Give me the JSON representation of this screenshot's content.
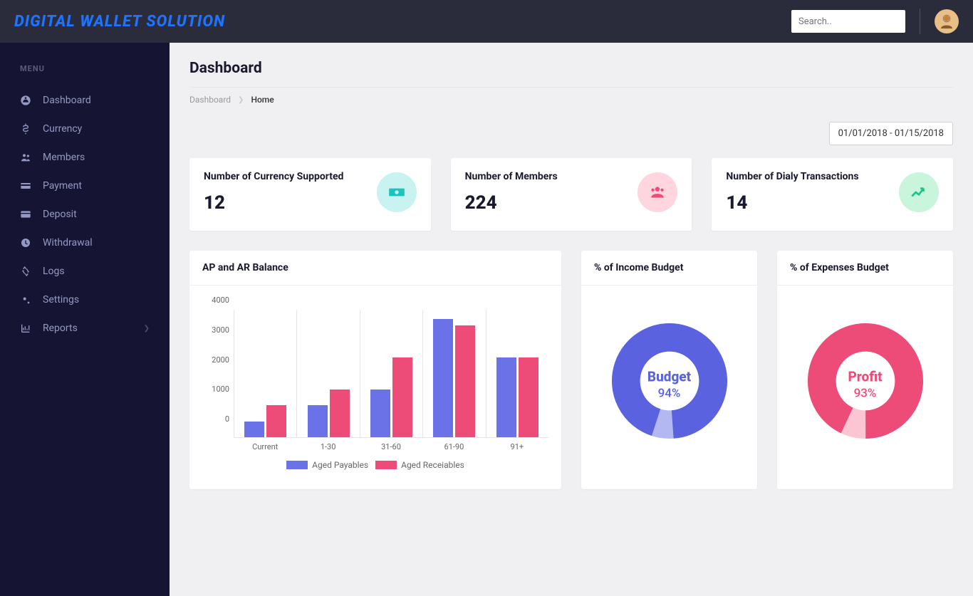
{
  "brand": "DIGITAL WALLET SOLUTION",
  "search": {
    "placeholder": "Search.."
  },
  "sidebar": {
    "menu_label": "MENU",
    "items": [
      {
        "label": "Dashboard",
        "icon": "dashboard-icon"
      },
      {
        "label": "Currency",
        "icon": "dollar-icon"
      },
      {
        "label": "Members",
        "icon": "users-icon"
      },
      {
        "label": "Payment",
        "icon": "payment-icon"
      },
      {
        "label": "Deposit",
        "icon": "card-icon"
      },
      {
        "label": "Withdrawal",
        "icon": "withdraw-icon"
      },
      {
        "label": "Logs",
        "icon": "recycle-icon"
      },
      {
        "label": "Settings",
        "icon": "gears-icon"
      },
      {
        "label": "Reports",
        "icon": "chart-icon",
        "has_children": true
      }
    ]
  },
  "page": {
    "title": "Dashboard",
    "breadcrumb": {
      "root": "Dashboard",
      "current": "Home"
    }
  },
  "date_range": "01/01/2018 - 01/15/2018",
  "stats": [
    {
      "label": "Number of Currency Supported",
      "value": "12",
      "icon": "money-icon",
      "color": "teal"
    },
    {
      "label": "Number of Members",
      "value": "224",
      "icon": "users-icon",
      "color": "pink"
    },
    {
      "label": "Number of Dialy Transactions",
      "value": "14",
      "icon": "trend-icon",
      "color": "green"
    }
  ],
  "charts": {
    "bar": {
      "title": "AP and AR Balance"
    },
    "income": {
      "title": "% of Income Budget",
      "center_label": "Budget",
      "percent": "94%"
    },
    "expense": {
      "title": "% of Expenses Budget",
      "center_label": "Profit",
      "percent": "93%"
    }
  },
  "chart_data": [
    {
      "type": "bar",
      "title": "AP and AR Balance",
      "categories": [
        "Current",
        "1-30",
        "31-60",
        "61-90",
        "91+"
      ],
      "series": [
        {
          "name": "Aged Payables",
          "values": [
            500,
            1000,
            1500,
            3700,
            2500
          ],
          "color": "#6b72e8"
        },
        {
          "name": "Aged Receiables",
          "values": [
            1000,
            1500,
            2500,
            3500,
            2500
          ],
          "color": "#ee4c78"
        }
      ],
      "ylim": [
        0,
        4000
      ],
      "yticks": [
        0,
        1000,
        2000,
        3000,
        4000
      ]
    },
    {
      "type": "pie",
      "title": "% of Income Budget",
      "center_label": "Budget",
      "series": [
        {
          "name": "Budget",
          "value": 94,
          "color": "#5a62e0"
        },
        {
          "name": "Remaining",
          "value": 6,
          "color": "#b4b8f2"
        }
      ]
    },
    {
      "type": "pie",
      "title": "% of Expenses Budget",
      "center_label": "Profit",
      "series": [
        {
          "name": "Profit",
          "value": 93,
          "color": "#ee4c78"
        },
        {
          "name": "Remaining",
          "value": 7,
          "color": "#fcc5d4"
        }
      ]
    }
  ]
}
